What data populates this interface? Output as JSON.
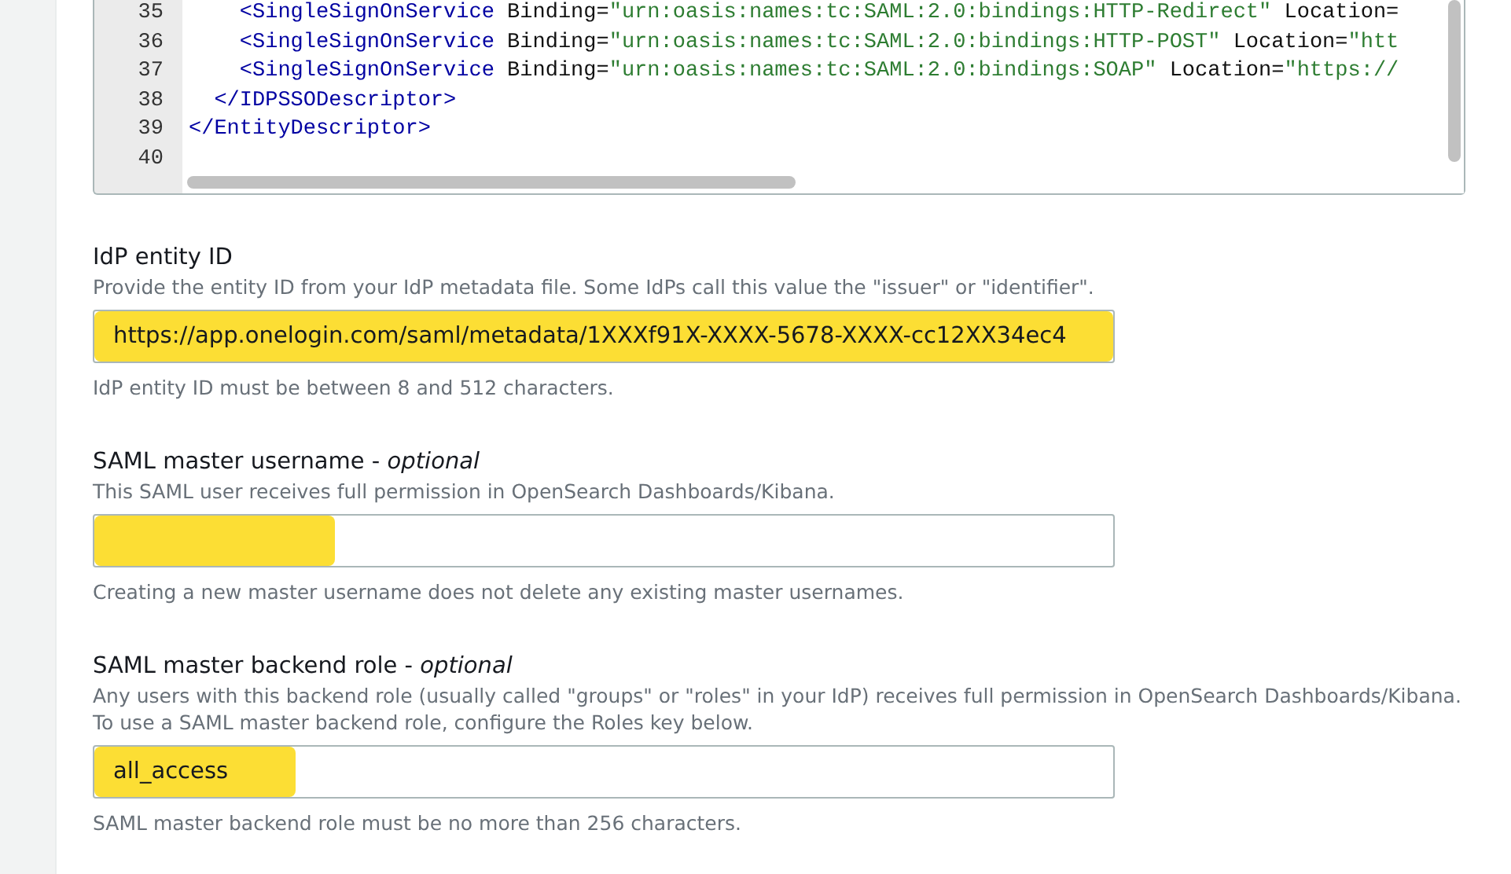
{
  "editor": {
    "lines": [
      {
        "number": "35",
        "tokens": [
          {
            "kind": "tag",
            "text": "    <SingleSignOnService"
          },
          {
            "kind": "attr",
            "text": " Binding="
          },
          {
            "kind": "string",
            "text": "\"urn:oasis:names:tc:SAML:2.0:bindings:HTTP-Redirect\""
          },
          {
            "kind": "attr",
            "text": " Location="
          }
        ]
      },
      {
        "number": "36",
        "tokens": [
          {
            "kind": "tag",
            "text": "    <SingleSignOnService"
          },
          {
            "kind": "attr",
            "text": " Binding="
          },
          {
            "kind": "string",
            "text": "\"urn:oasis:names:tc:SAML:2.0:bindings:HTTP-POST\""
          },
          {
            "kind": "attr",
            "text": " Location="
          },
          {
            "kind": "string",
            "text": "\"htt"
          }
        ]
      },
      {
        "number": "37",
        "tokens": [
          {
            "kind": "tag",
            "text": "    <SingleSignOnService"
          },
          {
            "kind": "attr",
            "text": " Binding="
          },
          {
            "kind": "string",
            "text": "\"urn:oasis:names:tc:SAML:2.0:bindings:SOAP\""
          },
          {
            "kind": "attr",
            "text": " Location="
          },
          {
            "kind": "string",
            "text": "\"https://"
          }
        ]
      },
      {
        "number": "38",
        "tokens": [
          {
            "kind": "tag",
            "text": "  </IDPSSODescriptor>"
          }
        ]
      },
      {
        "number": "39",
        "tokens": [
          {
            "kind": "tag",
            "text": "</EntityDescriptor>"
          }
        ]
      },
      {
        "number": "40"
      }
    ]
  },
  "fields": [
    {
      "label": "IdP entity ID",
      "description": "Provide the entity ID from your IdP metadata file. Some IdPs call this value the \"issuer\" or \"identifier\".",
      "value": "https://app.onelogin.com/saml/metadata/1XXXf91X-XXXX-5678-XXXX-cc12XX34ec4",
      "highlighted": true,
      "hint": "IdP entity ID must be between 8 and 512 characters."
    },
    {
      "label": "SAML master username - ",
      "optional": "optional",
      "description": "This SAML user receives full permission in OpenSearch Dashboards/Kibana.",
      "highlighted": true,
      "hint": "Creating a new master username does not delete any existing master usernames."
    },
    {
      "label": "SAML master backend role - ",
      "optional": "optional",
      "description": "Any users with this backend role (usually called \"groups\" or \"roles\" in your IdP) receives full permission in OpenSearch Dashboards/Kibana. To use a SAML master backend role, configure the Roles key below.",
      "value": "all_access",
      "highlighted": true,
      "hint": "SAML master backend role must be no more than 256 characters."
    }
  ]
}
